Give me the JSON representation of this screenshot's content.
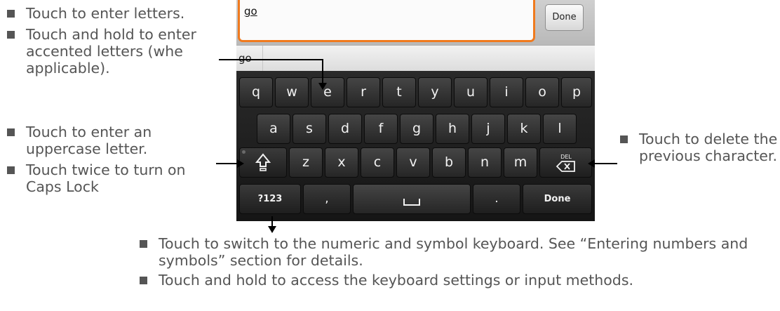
{
  "annotations": {
    "left_top": [
      "Touch to enter letters.",
      "Touch and hold to enter accented letters (whe applicable)."
    ],
    "left_bottom": [
      "Touch to enter an uppercase letter.",
      "Touch twice to turn on Caps Lock"
    ],
    "right": [
      "Touch to delete the previous character."
    ],
    "bottom": [
      "Touch to switch to the numeric and symbol keyboard. See “Entering numbers and symbols” section for details.",
      "Touch and hold to access the keyboard settings or input methods."
    ]
  },
  "editor": {
    "text_value": "go",
    "done_label": "Done"
  },
  "suggestions": [
    "go"
  ],
  "keyboard": {
    "row1": [
      "q",
      "w",
      "e",
      "r",
      "t",
      "y",
      "u",
      "i",
      "o",
      "p"
    ],
    "row2": [
      "a",
      "s",
      "d",
      "f",
      "g",
      "h",
      "j",
      "k",
      "l"
    ],
    "row3": [
      "z",
      "x",
      "c",
      "v",
      "b",
      "n",
      "m"
    ],
    "symbols_label": "?123",
    "comma_label": ",",
    "period_label": ".",
    "done_label": "Done",
    "delete_label": "DEL",
    "shift_icon": "shift-icon",
    "delete_icon": "backspace-icon",
    "space_icon": "space-icon"
  },
  "colors": {
    "focus_border": "#f07a1e",
    "key_bg": "#333333",
    "text": "#555555"
  }
}
